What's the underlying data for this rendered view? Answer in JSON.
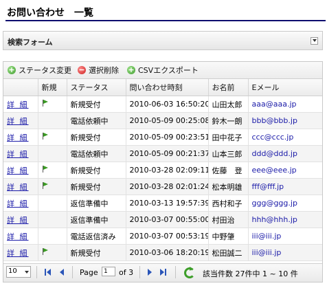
{
  "page": {
    "title": "お問い合わせ　一覧"
  },
  "search": {
    "title": "検索フォーム"
  },
  "toolbar": {
    "status_change": "ステータス変更",
    "delete_selected": "選択削除",
    "csv_export": "CSVエクスポート"
  },
  "table": {
    "headers": [
      "",
      "新規",
      "ステータス",
      "問い合わせ時刻",
      "お名前",
      "Eメール"
    ],
    "detail_label": "詳 細",
    "rows": [
      {
        "new": true,
        "status": "新規受付",
        "time": "2010-06-03 16:50:20",
        "name": "山田太郎",
        "email": "aaa@aaa.jp"
      },
      {
        "new": false,
        "status": "電話依頼中",
        "time": "2010-05-09 00:25:08",
        "name": "鈴木一朗",
        "email": "bbb@bbb.jp"
      },
      {
        "new": true,
        "status": "新規受付",
        "time": "2010-05-09 00:23:51",
        "name": "田中花子",
        "email": "ccc@ccc.jp"
      },
      {
        "new": false,
        "status": "電話依頼中",
        "time": "2010-05-09 00:21:37",
        "name": "山本三郎",
        "email": "ddd@ddd.jp"
      },
      {
        "new": true,
        "status": "新規受付",
        "time": "2010-03-28 02:09:11",
        "name": "佐藤　登",
        "email": "eee@eee.jp"
      },
      {
        "new": true,
        "status": "新規受付",
        "time": "2010-03-28 02:01:24",
        "name": "松本明雄",
        "email": "fff@fff.jp"
      },
      {
        "new": false,
        "status": "返信準備中",
        "time": "2010-03-13 19:57:39",
        "name": "西村和子",
        "email": "ggg@ggg.jp"
      },
      {
        "new": false,
        "status": "返信準備中",
        "time": "2010-03-07 00:55:00",
        "name": "村田治",
        "email": "hhh@hhh.jp"
      },
      {
        "new": false,
        "status": "電話返信済み",
        "time": "2010-03-07 00:53:19",
        "name": "中野肇",
        "email": "iii@iii.jp"
      },
      {
        "new": true,
        "status": "新規受付",
        "time": "2010-03-06 18:20:19",
        "name": "松田誠二",
        "email": "iii@iii.jp"
      }
    ]
  },
  "pager": {
    "page_size": "10",
    "page_label": "Page",
    "page_value": "1",
    "of_label": "of 3",
    "summary": "該当件数 27件中 1 ~ 10 件"
  },
  "colors": {
    "title_rule": "#0d0d6e",
    "link": "#1a1aa8",
    "flag": "#3a9a22",
    "nav": "#2a55b8"
  }
}
